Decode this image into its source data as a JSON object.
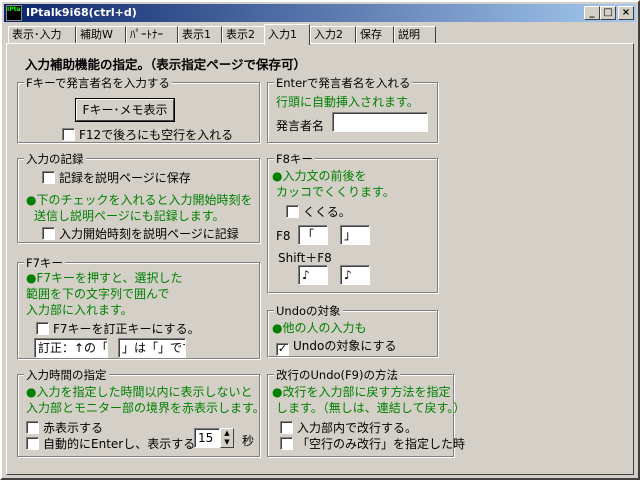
{
  "window": {
    "title": "IPtalk9i68(ctrl+d)",
    "icon_text": "IPtalk",
    "buttons": {
      "minimize": "_",
      "maximize": "□",
      "close": "×"
    }
  },
  "tabs": [
    {
      "label": "表示･入力"
    },
    {
      "label": "補助W"
    },
    {
      "label": "ﾊﾟｰﾄﾅｰ"
    },
    {
      "label": "表示1"
    },
    {
      "label": "表示2"
    },
    {
      "label": "入力1",
      "active": true
    },
    {
      "label": "入力2"
    },
    {
      "label": "保存"
    },
    {
      "label": "説明"
    }
  ],
  "page": {
    "heading": "入力補助機能の指定。（表示指定ページで保存可）",
    "fkey": {
      "legend": "Fキーで発言者名を入力する",
      "memo_button": "Fキー･メモ表示",
      "f12_check": "F12で後ろにも空行を入れる"
    },
    "record": {
      "legend": "入力の記録",
      "save_check": "記録を説明ページに保存",
      "note_line1": "●下のチェックを入れると入力開始時刻を",
      "note_line2": "送信し説明ページにも記録します。",
      "time_check": "入力開始時刻を説明ページに記録"
    },
    "f7": {
      "legend": "F7キー",
      "note_line1": "●F7キーを押すと、選択した",
      "note_line2": "範囲を下の文字列で囲んで",
      "note_line3": "入力部に入れます。",
      "correction_check": "F7キーを訂正キーにする。",
      "before_field": "訂正：↑の「",
      "after_field": "」は「」です。"
    },
    "input_time": {
      "legend": "入力時間の指定",
      "note_line1": "●入力を指定した時間以内に表示しないと",
      "note_line2": "入力部とモニター部の境界を赤表示します。",
      "red_check": "赤表示する",
      "auto_enter_check": "自動的にEnterし、表示する",
      "seconds_value": "15",
      "seconds_unit": "秒"
    },
    "enter": {
      "legend": "Enterで発言者名を入れる",
      "note": "行頭に自動挿入されます。",
      "speaker_label": "発言者名",
      "speaker_value": ""
    },
    "f8": {
      "legend": "F8キー",
      "note_line1": "●入力文の前後を",
      "note_line2": "カッコでくくります。",
      "wrap_check": "くくる。",
      "f8_label": "F8",
      "f8_open": "「",
      "f8_close": "」",
      "shift_label": "Shift＋F8",
      "shift_open": "♪",
      "shift_close": "♪"
    },
    "undo": {
      "legend": "Undoの対象",
      "note": "●他の人の入力も",
      "target_check": "Undoの対象にする",
      "target_checked_mark": "✓"
    },
    "newline_undo": {
      "legend": "改行のUndo(F9)の方法",
      "note_line1": "●改行を入力部に戻す方法を指定",
      "note_line2": "します。（無しは、連結して戻す。）",
      "in_input_check": "入力部内で改行する。",
      "blank_only_check": "「空行のみ改行」を指定した時"
    }
  }
}
